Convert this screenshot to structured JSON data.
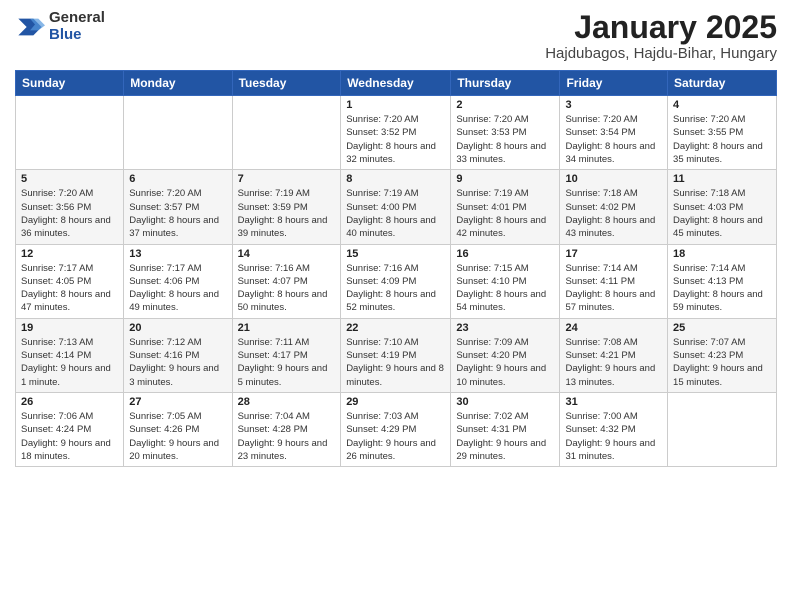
{
  "logo": {
    "general": "General",
    "blue": "Blue"
  },
  "title": {
    "month": "January 2025",
    "location": "Hajdubagos, Hajdu-Bihar, Hungary"
  },
  "weekdays": [
    "Sunday",
    "Monday",
    "Tuesday",
    "Wednesday",
    "Thursday",
    "Friday",
    "Saturday"
  ],
  "weeks": [
    [
      {
        "day": "",
        "info": ""
      },
      {
        "day": "",
        "info": ""
      },
      {
        "day": "",
        "info": ""
      },
      {
        "day": "1",
        "info": "Sunrise: 7:20 AM\nSunset: 3:52 PM\nDaylight: 8 hours and 32 minutes."
      },
      {
        "day": "2",
        "info": "Sunrise: 7:20 AM\nSunset: 3:53 PM\nDaylight: 8 hours and 33 minutes."
      },
      {
        "day": "3",
        "info": "Sunrise: 7:20 AM\nSunset: 3:54 PM\nDaylight: 8 hours and 34 minutes."
      },
      {
        "day": "4",
        "info": "Sunrise: 7:20 AM\nSunset: 3:55 PM\nDaylight: 8 hours and 35 minutes."
      }
    ],
    [
      {
        "day": "5",
        "info": "Sunrise: 7:20 AM\nSunset: 3:56 PM\nDaylight: 8 hours and 36 minutes."
      },
      {
        "day": "6",
        "info": "Sunrise: 7:20 AM\nSunset: 3:57 PM\nDaylight: 8 hours and 37 minutes."
      },
      {
        "day": "7",
        "info": "Sunrise: 7:19 AM\nSunset: 3:59 PM\nDaylight: 8 hours and 39 minutes."
      },
      {
        "day": "8",
        "info": "Sunrise: 7:19 AM\nSunset: 4:00 PM\nDaylight: 8 hours and 40 minutes."
      },
      {
        "day": "9",
        "info": "Sunrise: 7:19 AM\nSunset: 4:01 PM\nDaylight: 8 hours and 42 minutes."
      },
      {
        "day": "10",
        "info": "Sunrise: 7:18 AM\nSunset: 4:02 PM\nDaylight: 8 hours and 43 minutes."
      },
      {
        "day": "11",
        "info": "Sunrise: 7:18 AM\nSunset: 4:03 PM\nDaylight: 8 hours and 45 minutes."
      }
    ],
    [
      {
        "day": "12",
        "info": "Sunrise: 7:17 AM\nSunset: 4:05 PM\nDaylight: 8 hours and 47 minutes."
      },
      {
        "day": "13",
        "info": "Sunrise: 7:17 AM\nSunset: 4:06 PM\nDaylight: 8 hours and 49 minutes."
      },
      {
        "day": "14",
        "info": "Sunrise: 7:16 AM\nSunset: 4:07 PM\nDaylight: 8 hours and 50 minutes."
      },
      {
        "day": "15",
        "info": "Sunrise: 7:16 AM\nSunset: 4:09 PM\nDaylight: 8 hours and 52 minutes."
      },
      {
        "day": "16",
        "info": "Sunrise: 7:15 AM\nSunset: 4:10 PM\nDaylight: 8 hours and 54 minutes."
      },
      {
        "day": "17",
        "info": "Sunrise: 7:14 AM\nSunset: 4:11 PM\nDaylight: 8 hours and 57 minutes."
      },
      {
        "day": "18",
        "info": "Sunrise: 7:14 AM\nSunset: 4:13 PM\nDaylight: 8 hours and 59 minutes."
      }
    ],
    [
      {
        "day": "19",
        "info": "Sunrise: 7:13 AM\nSunset: 4:14 PM\nDaylight: 9 hours and 1 minute."
      },
      {
        "day": "20",
        "info": "Sunrise: 7:12 AM\nSunset: 4:16 PM\nDaylight: 9 hours and 3 minutes."
      },
      {
        "day": "21",
        "info": "Sunrise: 7:11 AM\nSunset: 4:17 PM\nDaylight: 9 hours and 5 minutes."
      },
      {
        "day": "22",
        "info": "Sunrise: 7:10 AM\nSunset: 4:19 PM\nDaylight: 9 hours and 8 minutes."
      },
      {
        "day": "23",
        "info": "Sunrise: 7:09 AM\nSunset: 4:20 PM\nDaylight: 9 hours and 10 minutes."
      },
      {
        "day": "24",
        "info": "Sunrise: 7:08 AM\nSunset: 4:21 PM\nDaylight: 9 hours and 13 minutes."
      },
      {
        "day": "25",
        "info": "Sunrise: 7:07 AM\nSunset: 4:23 PM\nDaylight: 9 hours and 15 minutes."
      }
    ],
    [
      {
        "day": "26",
        "info": "Sunrise: 7:06 AM\nSunset: 4:24 PM\nDaylight: 9 hours and 18 minutes."
      },
      {
        "day": "27",
        "info": "Sunrise: 7:05 AM\nSunset: 4:26 PM\nDaylight: 9 hours and 20 minutes."
      },
      {
        "day": "28",
        "info": "Sunrise: 7:04 AM\nSunset: 4:28 PM\nDaylight: 9 hours and 23 minutes."
      },
      {
        "day": "29",
        "info": "Sunrise: 7:03 AM\nSunset: 4:29 PM\nDaylight: 9 hours and 26 minutes."
      },
      {
        "day": "30",
        "info": "Sunrise: 7:02 AM\nSunset: 4:31 PM\nDaylight: 9 hours and 29 minutes."
      },
      {
        "day": "31",
        "info": "Sunrise: 7:00 AM\nSunset: 4:32 PM\nDaylight: 9 hours and 31 minutes."
      },
      {
        "day": "",
        "info": ""
      }
    ]
  ]
}
